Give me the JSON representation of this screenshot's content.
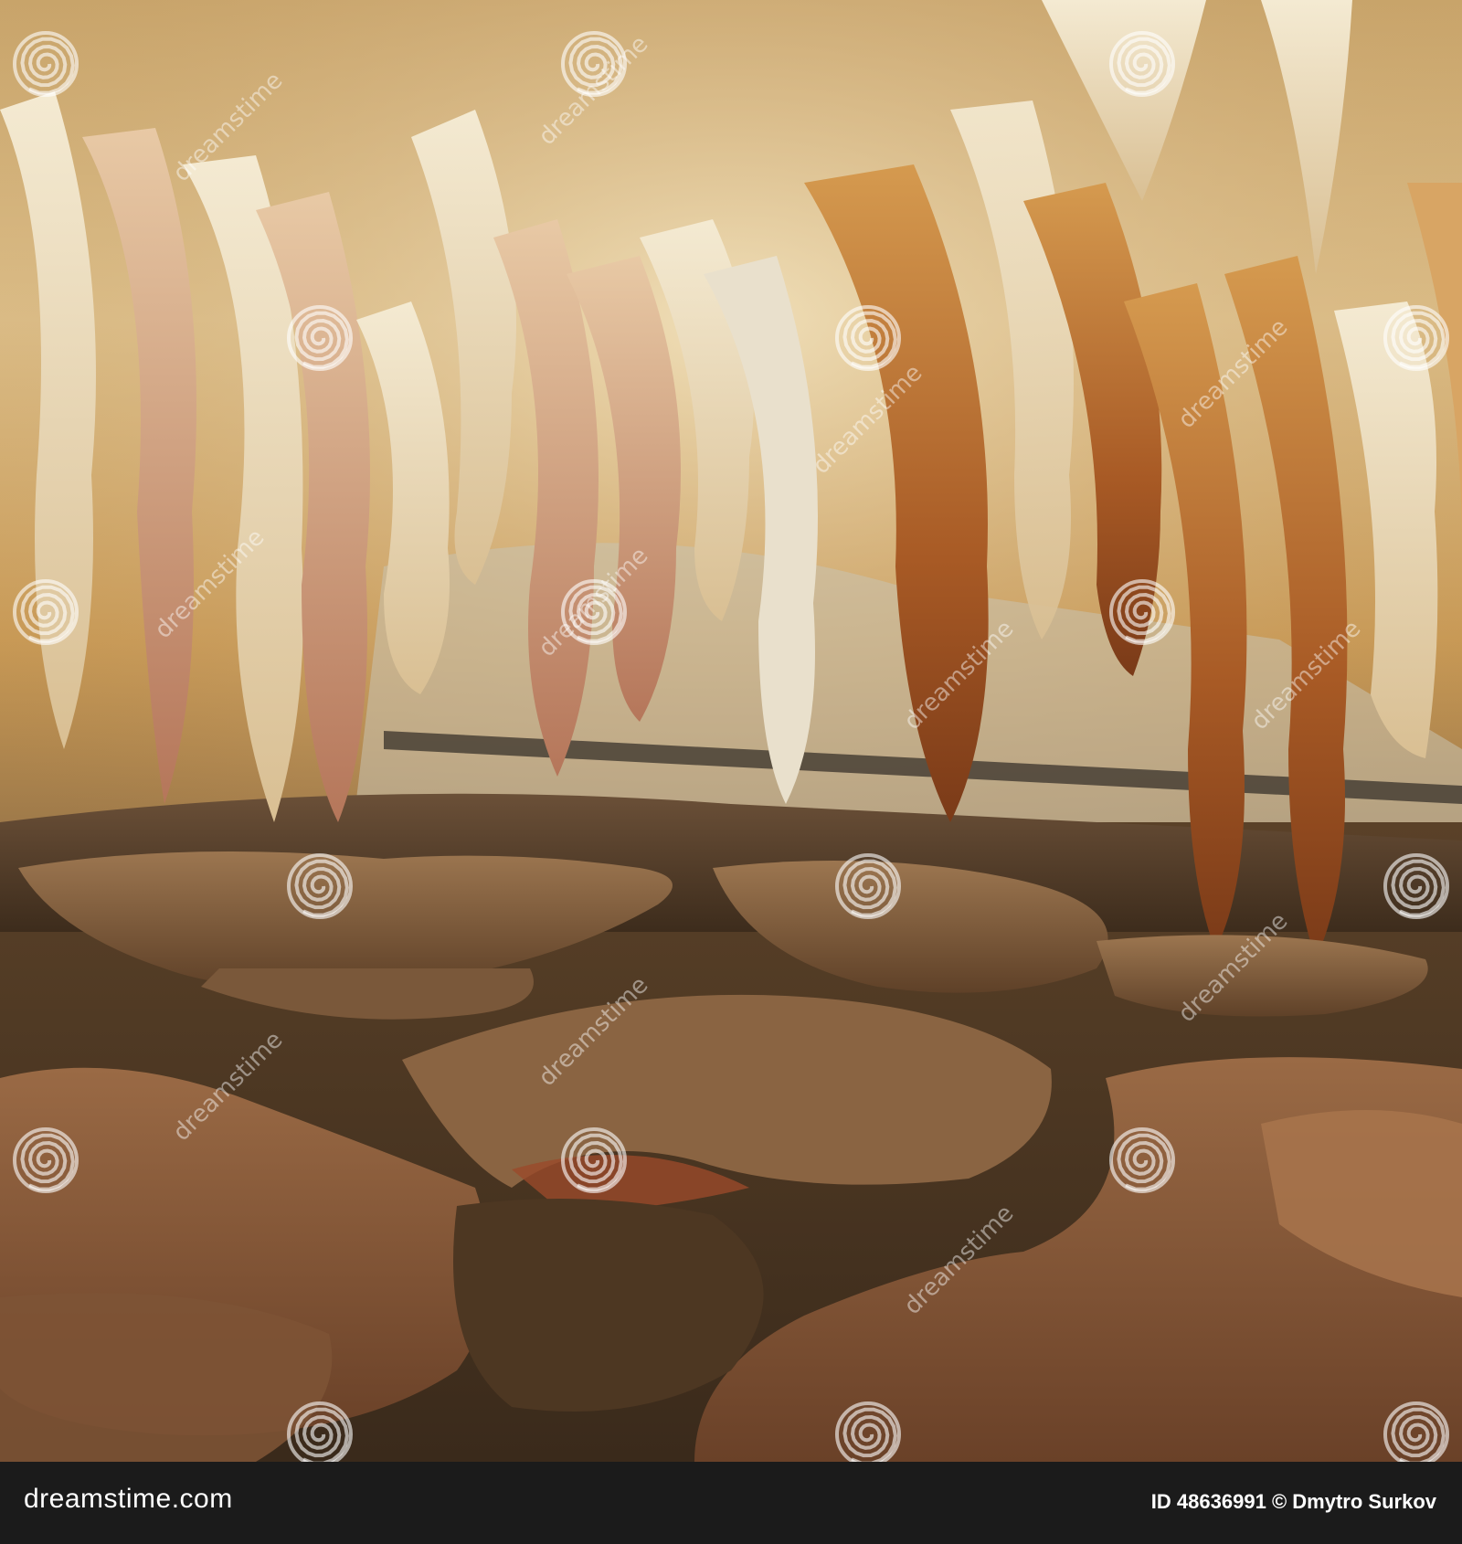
{
  "footer": {
    "brand": "dreamstime.com",
    "id_label": "ID",
    "id_value": "48636991",
    "copyright_symbol": "©",
    "author": "Dmytro Surkov"
  },
  "watermark": {
    "text": "dreamstime",
    "icon": "spiral-logo-icon"
  },
  "colors": {
    "footer_bg": "#1b1b1b",
    "footer_text": "#ffffff",
    "rock_light": "#e8d3a6",
    "rock_ochre": "#c98a3f",
    "rock_rust": "#8f4a22",
    "water_dark": "#4a3520"
  }
}
